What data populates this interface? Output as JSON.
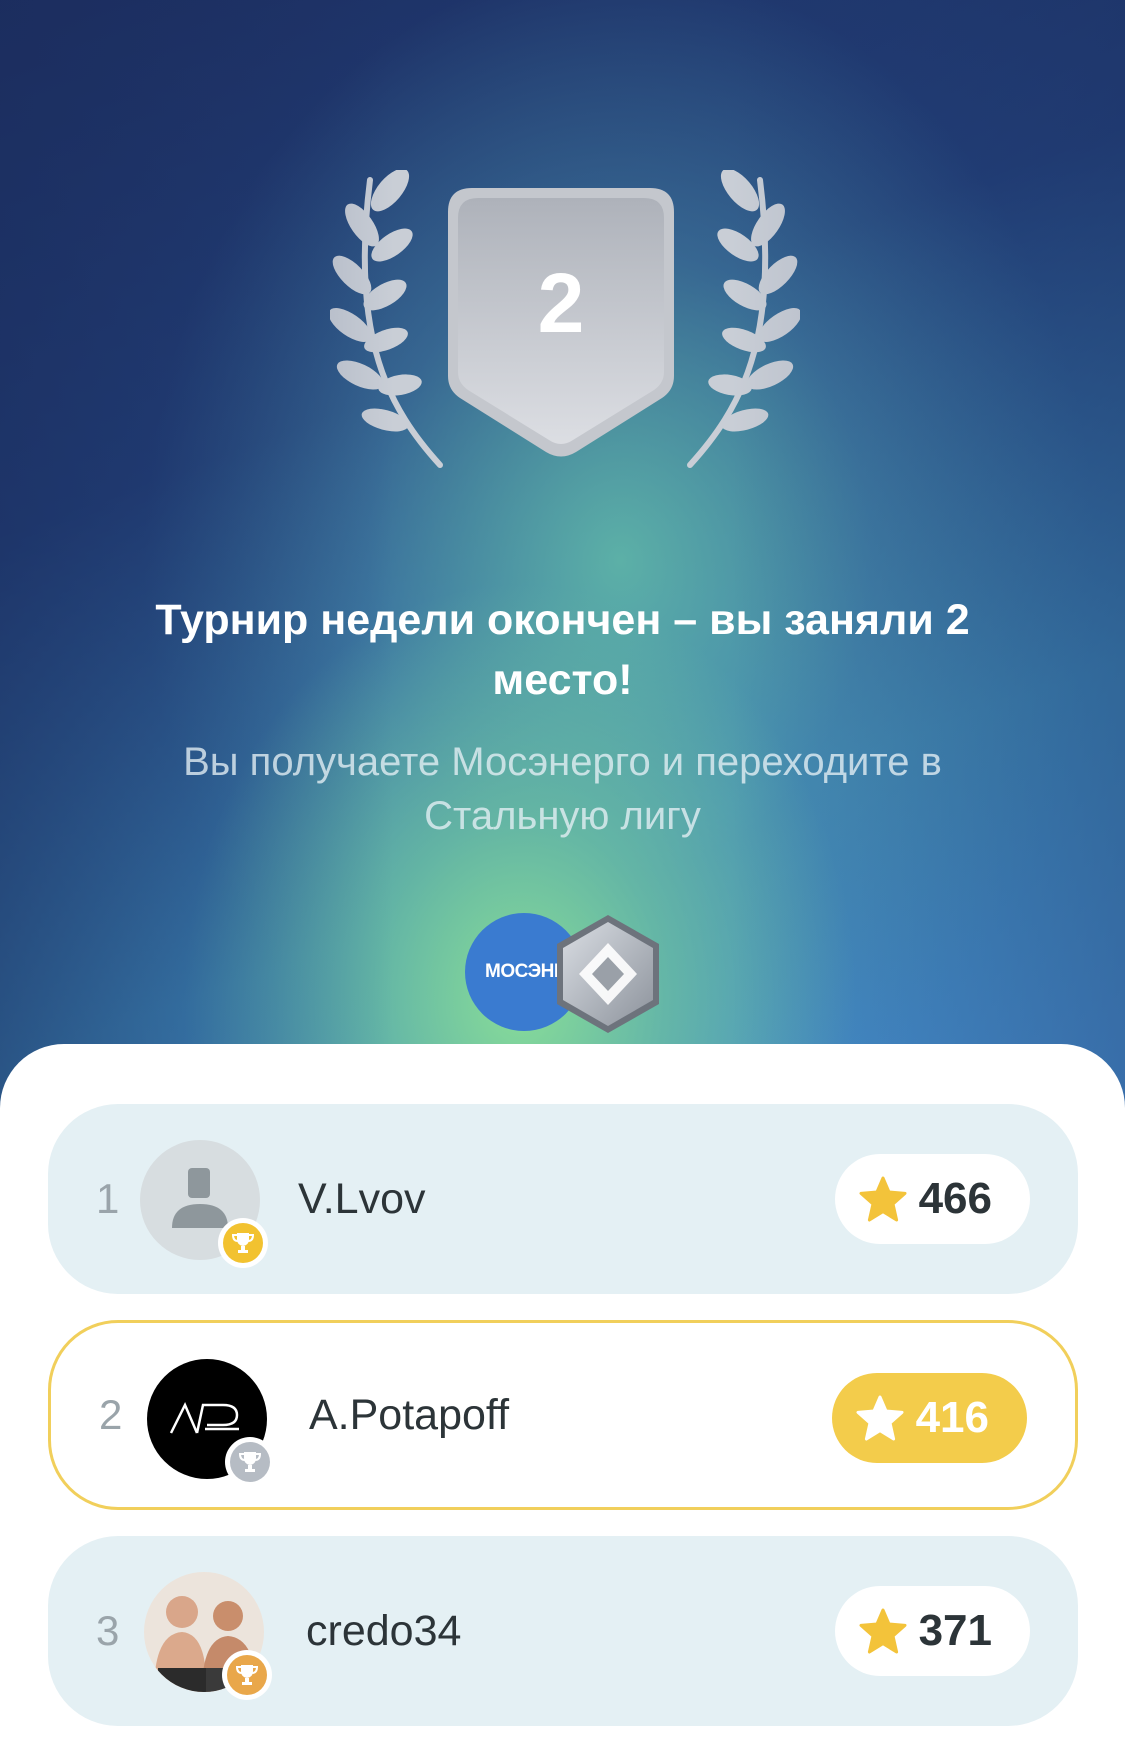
{
  "result": {
    "place": "2",
    "title": "Турнир недели окончен – вы заняли 2 место!",
    "subtitle": "Вы получаете Мосэнерго и переходите в Стальную лигу",
    "reward_logo_text": "МОСЭНЕРГО"
  },
  "leaderboard": [
    {
      "rank": "1",
      "name": "V.Lvov",
      "score": "466",
      "highlight": false,
      "trophy": "gold"
    },
    {
      "rank": "2",
      "name": "A.Potapoff",
      "score": "416",
      "highlight": true,
      "trophy": "silver"
    },
    {
      "rank": "3",
      "name": "credo34",
      "score": "371",
      "highlight": false,
      "trophy": "bronze"
    }
  ],
  "colors": {
    "highlight_border": "#f1cf5b",
    "score_gold": "#f3cc4b",
    "row_bg": "#e4f0f4",
    "star": "#f3c33a"
  },
  "icons": [
    "laurel-icon",
    "place-shield-icon",
    "league-badge-icon",
    "star-icon",
    "trophy-icon",
    "default-avatar-icon"
  ]
}
